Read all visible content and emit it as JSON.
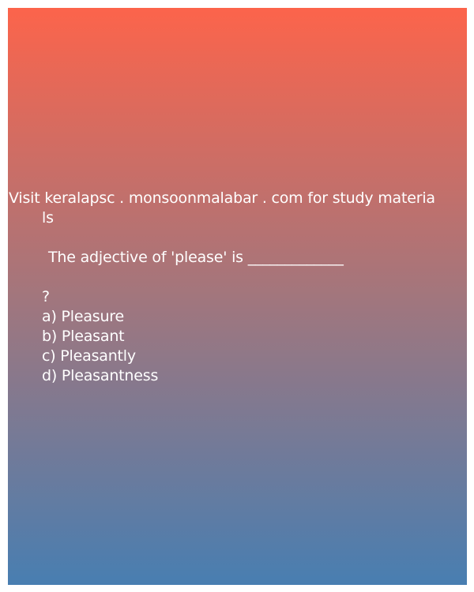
{
  "source": {
    "line1": "Visit keralapsc . monsoonmalabar . com for study materia",
    "line2": "ls"
  },
  "question": {
    "text": "The adjective of 'please' is _____________",
    "mark": "?"
  },
  "options": [
    {
      "label": "a) Pleasure"
    },
    {
      "label": "b) Pleasant"
    },
    {
      "label": "c) Pleasantly"
    },
    {
      "label": "d) Pleasantness"
    }
  ],
  "colors": {
    "gradient_top": "#fc644b",
    "gradient_mid": "#a2767d",
    "gradient_bottom": "#487eb1",
    "text": "#ffffff"
  }
}
